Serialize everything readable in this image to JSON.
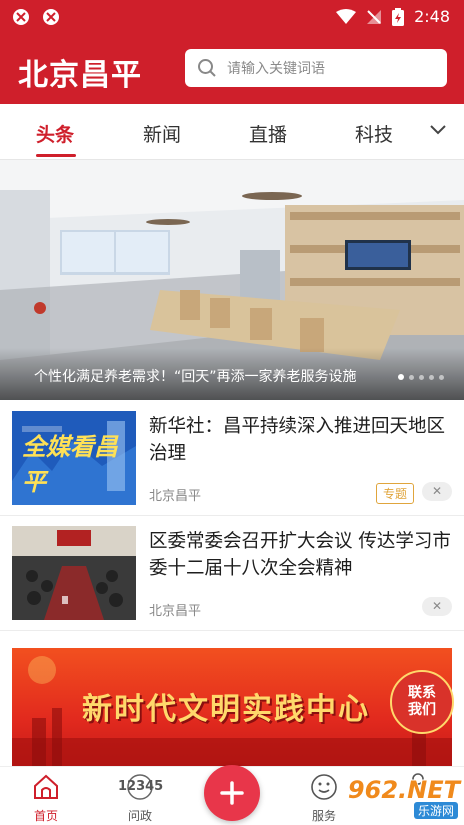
{
  "status_bar": {
    "time": "2:48",
    "icons": [
      "app-notification-icon",
      "app-notification-icon",
      "wifi-icon",
      "no-signal-icon",
      "battery-charging-icon"
    ]
  },
  "header": {
    "app_title": "北京昌平",
    "search_placeholder": "请输入关键词语"
  },
  "tabs": [
    {
      "label": "头条",
      "active": true
    },
    {
      "label": "新闻",
      "active": false
    },
    {
      "label": "直播",
      "active": false
    },
    {
      "label": "科技",
      "active": false
    }
  ],
  "hero": {
    "caption": "个性化满足养老需求！“回天”再添一家养老服务设施",
    "slide_count": 5,
    "current_slide": 1
  },
  "news": [
    {
      "title": "新华社：昌平持续深入推进回天地区治理",
      "source": "北京昌平",
      "tag": "专题",
      "thumb_text": "全媒看昌平"
    },
    {
      "title": "区委常委会召开扩大会议 传达学习市委十二届十八次全会精神",
      "source": "北京昌平",
      "tag": ""
    }
  ],
  "banner": {
    "text": "新时代文明实践中心",
    "contact_label": "联系我们"
  },
  "bottom_nav": [
    {
      "label": "首页",
      "active": true
    },
    {
      "label": "问政",
      "icon_text": "12345"
    },
    {
      "label": "服务"
    }
  ],
  "watermark": {
    "text": "962.NET",
    "subtext": "乐游网"
  },
  "colors": {
    "brand_red": "#cf1f2b",
    "fab_red": "#e8364a",
    "tag_orange": "#e0a53c"
  }
}
